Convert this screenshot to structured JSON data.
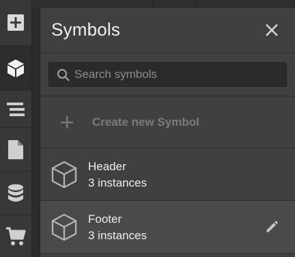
{
  "panel": {
    "title": "Symbols"
  },
  "search": {
    "placeholder": "Search symbols",
    "value": ""
  },
  "create": {
    "label": "Create new Symbol"
  },
  "symbols": [
    {
      "name": "Header",
      "count": "3 instances"
    },
    {
      "name": "Footer",
      "count": "3 instances"
    }
  ],
  "rail": {
    "items": [
      {
        "icon": "add-panel-icon"
      },
      {
        "icon": "symbols-cube-icon",
        "active": true
      },
      {
        "icon": "navigator-icon"
      },
      {
        "icon": "pages-icon"
      },
      {
        "icon": "cms-database-icon"
      },
      {
        "icon": "ecommerce-cart-icon"
      }
    ]
  },
  "colors": {
    "panel_bg": "#404040",
    "rail_bg": "#383838",
    "text": "#eeeeee",
    "muted": "#7b7b7b"
  }
}
